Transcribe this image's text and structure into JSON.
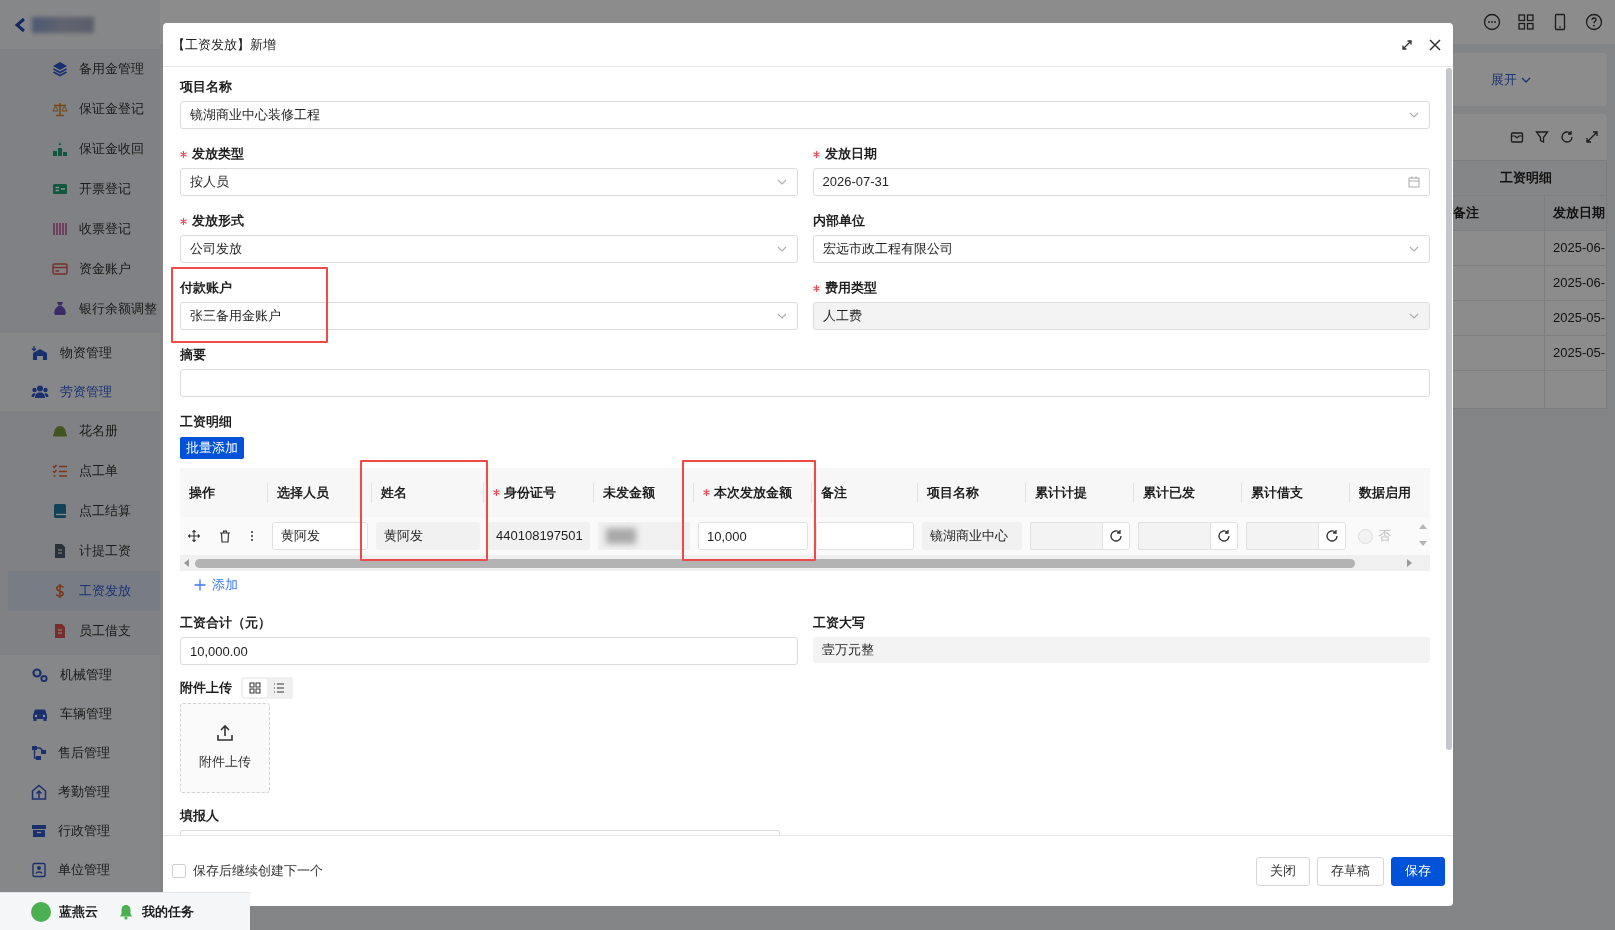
{
  "sidebar": {
    "items": [
      {
        "label": "备用金管理",
        "kind": "sub",
        "selected": false
      },
      {
        "label": "保证金登记",
        "kind": "sub",
        "selected": false
      },
      {
        "label": "保证金收回",
        "kind": "sub",
        "selected": false
      },
      {
        "label": "开票登记",
        "kind": "sub",
        "selected": false
      },
      {
        "label": "收票登记",
        "kind": "sub",
        "selected": false
      },
      {
        "label": "资金账户",
        "kind": "sub",
        "selected": false
      },
      {
        "label": "银行余额调整",
        "kind": "sub",
        "selected": false
      },
      {
        "label": "物资管理",
        "kind": "top",
        "selected": false,
        "expanded": false
      },
      {
        "label": "劳资管理",
        "kind": "top",
        "selected": false,
        "expanded": true
      },
      {
        "label": "花名册",
        "kind": "sub",
        "selected": false
      },
      {
        "label": "点工单",
        "kind": "sub",
        "selected": false
      },
      {
        "label": "点工结算",
        "kind": "sub",
        "selected": false
      },
      {
        "label": "计提工资",
        "kind": "sub",
        "selected": false
      },
      {
        "label": "工资发放",
        "kind": "sub",
        "selected": true
      },
      {
        "label": "员工借支",
        "kind": "sub",
        "selected": false
      },
      {
        "label": "机械管理",
        "kind": "top",
        "selected": false,
        "expanded": false
      },
      {
        "label": "车辆管理",
        "kind": "top",
        "selected": false,
        "expanded": false
      },
      {
        "label": "售后管理",
        "kind": "top",
        "selected": false,
        "expanded": false
      },
      {
        "label": "考勤管理",
        "kind": "top",
        "selected": false,
        "expanded": false
      },
      {
        "label": "行政管理",
        "kind": "top",
        "selected": false,
        "expanded": false
      },
      {
        "label": "单位管理",
        "kind": "top",
        "selected": false,
        "expanded": false
      }
    ],
    "footer": {
      "brand": "蓝燕云",
      "tasks": "我的任务"
    }
  },
  "filter": {
    "expand": "展开"
  },
  "background_table": {
    "group_header": "工资明细",
    "columns": [
      "备注",
      "发放日期"
    ],
    "rows": [
      {
        "date": "2025-06-"
      },
      {
        "date": "2025-06-"
      },
      {
        "date": "2025-05-"
      },
      {
        "date": "2025-05-"
      }
    ]
  },
  "dialog": {
    "title": "【工资发放】新增",
    "fields": [
      {
        "label": "项目名称",
        "required": false,
        "kind": "select",
        "value": "镜湖商业中心装修工程",
        "full_width": true,
        "disabled": false,
        "highlighted": false
      },
      {
        "label": "发放类型",
        "required": true,
        "kind": "select",
        "value": "按人员",
        "full_width": false,
        "disabled": false,
        "highlighted": false
      },
      {
        "label": "发放日期",
        "required": true,
        "kind": "date",
        "value": "2026-07-31",
        "full_width": false,
        "disabled": false,
        "highlighted": false
      },
      {
        "label": "发放形式",
        "required": true,
        "kind": "select",
        "value": "公司发放",
        "full_width": false,
        "disabled": false,
        "highlighted": false
      },
      {
        "label": "内部单位",
        "required": false,
        "kind": "select",
        "value": "宏远市政工程有限公司",
        "full_width": false,
        "disabled": false,
        "highlighted": false
      },
      {
        "label": "付款账户",
        "required": false,
        "kind": "select",
        "value": "张三备用金账户",
        "full_width": false,
        "disabled": false,
        "highlighted": true
      },
      {
        "label": "费用类型",
        "required": true,
        "kind": "select",
        "value": "人工费",
        "full_width": false,
        "disabled": true,
        "highlighted": false
      },
      {
        "label": "摘要",
        "required": false,
        "kind": "text",
        "full_width": true,
        "disabled": false,
        "highlighted": false
      }
    ],
    "detail": {
      "label": "工资明细",
      "batch_button": "批量添加",
      "columns": [
        {
          "label": "操作",
          "required": false,
          "highlighted": false
        },
        {
          "label": "选择人员",
          "required": false,
          "highlighted": false
        },
        {
          "label": "姓名",
          "required": false,
          "highlighted": true
        },
        {
          "label": "身份证号",
          "required": true,
          "highlighted": false
        },
        {
          "label": "未发金额",
          "required": false,
          "highlighted": false
        },
        {
          "label": "本次发放金额",
          "required": true,
          "highlighted": true
        },
        {
          "label": "备注",
          "required": false,
          "highlighted": false
        },
        {
          "label": "项目名称",
          "required": false,
          "highlighted": false
        },
        {
          "label": "累计计提",
          "required": false,
          "highlighted": false
        },
        {
          "label": "累计已发",
          "required": false,
          "highlighted": false
        },
        {
          "label": "累计借支",
          "required": false,
          "highlighted": false
        },
        {
          "label": "数据启用",
          "required": false,
          "highlighted": false
        }
      ],
      "rows": [
        {
          "cells": [
            {
              "kind": "actions"
            },
            {
              "kind": "input",
              "value": "黄阿发"
            },
            {
              "kind": "readonly",
              "value": "黄阿发"
            },
            {
              "kind": "readonly",
              "value": "440108197501"
            },
            {
              "kind": "masked"
            },
            {
              "kind": "input",
              "value": "10,000"
            },
            {
              "kind": "input"
            },
            {
              "kind": "readonly",
              "value": "镜湖商业中心"
            },
            {
              "kind": "refresh"
            },
            {
              "kind": "refresh"
            },
            {
              "kind": "refresh"
            },
            {
              "kind": "radio",
              "disabled": true,
              "options": [
                {
                  "label": "否",
                  "selected": false
                }
              ]
            }
          ]
        }
      ],
      "add_link": "添加"
    },
    "total": {
      "label": "工资合计（元）",
      "value": "10,000.00"
    },
    "uppercase": {
      "label": "工资大写",
      "value": "壹万元整"
    },
    "attachments": {
      "label": "附件上传",
      "views": [
        {
          "selected": true
        },
        {
          "selected": false
        }
      ],
      "upload_text": "附件上传"
    },
    "reporter": {
      "label": "填报人"
    },
    "footer": {
      "continue_label": "保存后继续创建下一个",
      "continue_checked": false,
      "buttons": [
        {
          "label": "关闭",
          "kind": "default"
        },
        {
          "label": "存草稿",
          "kind": "default"
        },
        {
          "label": "保存",
          "kind": "primary"
        }
      ]
    }
  }
}
